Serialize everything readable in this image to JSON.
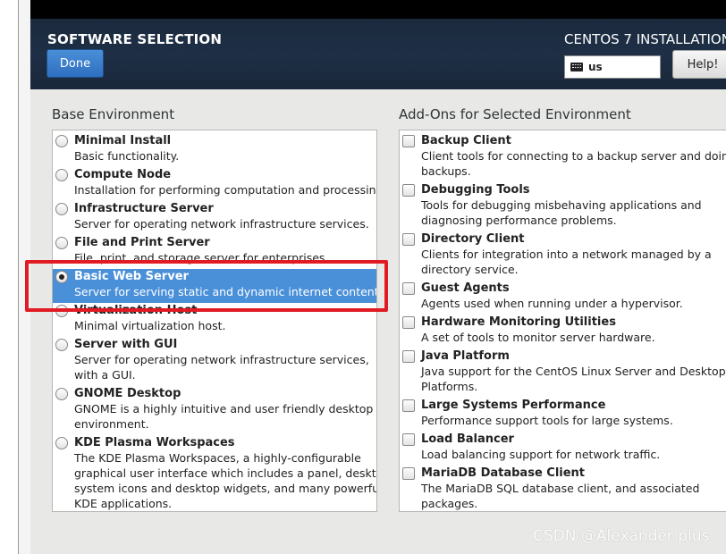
{
  "header": {
    "page_title": "SOFTWARE SELECTION",
    "done_label": "Done",
    "product_title": "CENTOS 7 INSTALLATION",
    "keyboard_layout": "us",
    "help_label": "Help!"
  },
  "base_environment": {
    "label": "Base Environment",
    "items": [
      {
        "title": "Minimal Install",
        "desc": [
          "Basic functionality."
        ],
        "selected": false
      },
      {
        "title": "Compute Node",
        "desc": [
          "Installation for performing computation and processing."
        ],
        "selected": false
      },
      {
        "title": "Infrastructure Server",
        "desc": [
          "Server for operating network infrastructure services."
        ],
        "selected": false
      },
      {
        "title": "File and Print Server",
        "desc": [
          "File, print, and storage server for enterprises."
        ],
        "selected": false
      },
      {
        "title": "Basic Web Server",
        "desc": [
          "Server for serving static and dynamic internet content."
        ],
        "selected": true
      },
      {
        "title": "Virtualization Host",
        "desc": [
          "Minimal virtualization host."
        ],
        "selected": false
      },
      {
        "title": "Server with GUI",
        "desc": [
          "Server for operating network infrastructure services,",
          "with a GUI."
        ],
        "selected": false
      },
      {
        "title": "GNOME Desktop",
        "desc": [
          "GNOME is a highly intuitive and user friendly desktop",
          "environment."
        ],
        "selected": false
      },
      {
        "title": "KDE Plasma Workspaces",
        "desc": [
          "The KDE Plasma Workspaces, a highly-configurable",
          "graphical user interface which includes a panel, desktop,",
          "system icons and desktop widgets, and many powerful",
          "KDE applications."
        ],
        "selected": false
      }
    ]
  },
  "addons": {
    "label": "Add-Ons for Selected Environment",
    "items": [
      {
        "title": "Backup Client",
        "desc": [
          "Client tools for connecting to a backup server and doing",
          "backups."
        ]
      },
      {
        "title": "Debugging Tools",
        "desc": [
          "Tools for debugging misbehaving applications and",
          "diagnosing performance problems."
        ]
      },
      {
        "title": "Directory Client",
        "desc": [
          "Clients for integration into a network managed by a",
          "directory service."
        ]
      },
      {
        "title": "Guest Agents",
        "desc": [
          "Agents used when running under a hypervisor."
        ]
      },
      {
        "title": "Hardware Monitoring Utilities",
        "desc": [
          "A set of tools to monitor server hardware."
        ]
      },
      {
        "title": "Java Platform",
        "desc": [
          "Java support for the CentOS Linux Server and Desktop",
          "Platforms."
        ]
      },
      {
        "title": "Large Systems Performance",
        "desc": [
          "Performance support tools for large systems."
        ]
      },
      {
        "title": "Load Balancer",
        "desc": [
          "Load balancing support for network traffic."
        ]
      },
      {
        "title": "MariaDB Database Client",
        "desc": [
          "The MariaDB SQL database client, and associated",
          "packages."
        ]
      }
    ]
  },
  "watermark": "CSDN @Alexander plus",
  "colors": {
    "selection": "#4a90d9",
    "annotation_box": "#e01b24",
    "header_bg": "#1e2f46"
  }
}
